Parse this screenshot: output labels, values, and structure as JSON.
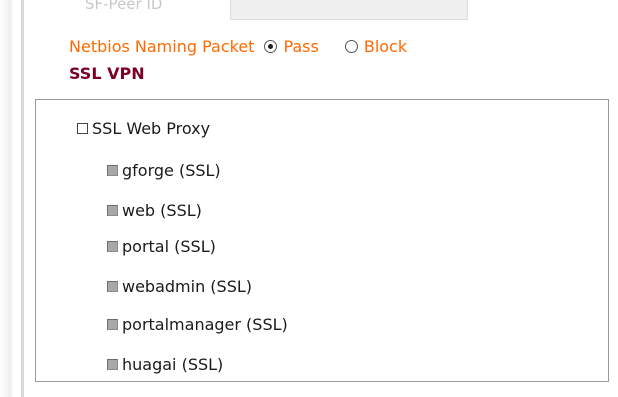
{
  "top_row": {
    "label": "SF-Peer ID"
  },
  "netbios": {
    "label": "Netbios Naming Packet",
    "options": [
      {
        "label": "Pass",
        "checked": true
      },
      {
        "label": "Block",
        "checked": false
      }
    ]
  },
  "ssl_vpn": {
    "title": "SSL VPN",
    "parent": {
      "label": "SSL Web Proxy",
      "checked": false
    },
    "children": [
      {
        "label": "gforge (SSL)",
        "checked": false,
        "disabled": true
      },
      {
        "label": "web (SSL)",
        "checked": false,
        "disabled": true
      },
      {
        "label": "portal (SSL)",
        "checked": false,
        "disabled": true
      },
      {
        "label": "webadmin (SSL)",
        "checked": false,
        "disabled": true
      },
      {
        "label": "portalmanager (SSL)",
        "checked": false,
        "disabled": true
      },
      {
        "label": "huagai (SSL)",
        "checked": false,
        "disabled": true
      }
    ]
  },
  "colors": {
    "netbios_text": "#ff6a00",
    "section_title": "#7a0026",
    "disabled_checkbox": "#a8a8a8"
  }
}
